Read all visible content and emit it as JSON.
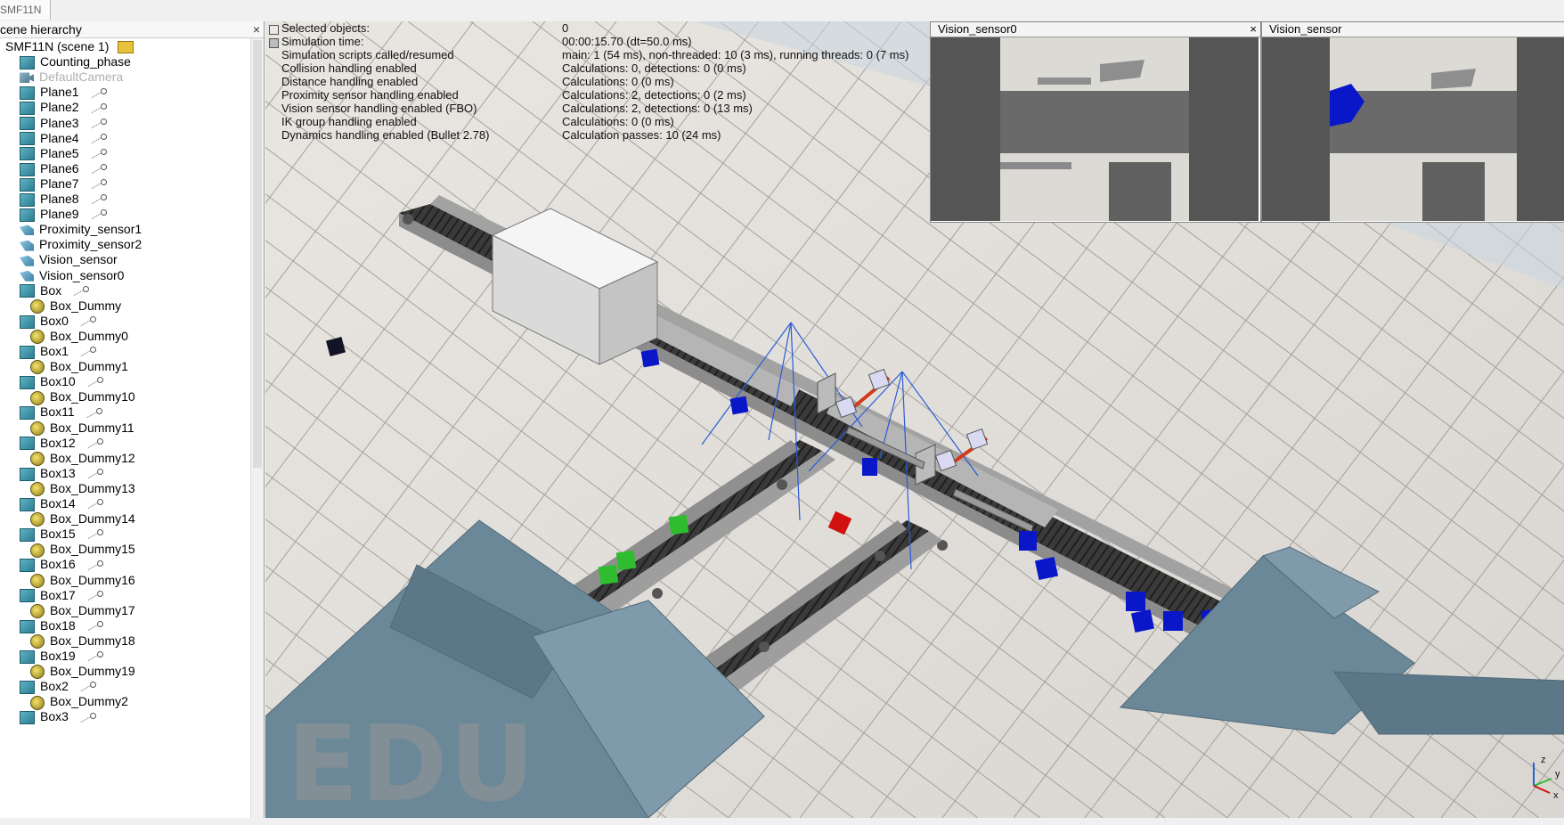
{
  "window": {
    "tab_title": "SMF11N"
  },
  "hierarchy": {
    "title": "cene hierarchy",
    "close": "×",
    "items": [
      {
        "label": "SMF11N (scene 1)",
        "icon": "scene-icon",
        "indent": 0
      },
      {
        "label": "Counting_phase",
        "icon": "box-icon",
        "indent": 1
      },
      {
        "label": "DefaultCamera",
        "icon": "camera-icon",
        "indent": 1,
        "disabled": true
      },
      {
        "label": "Plane1",
        "icon": "box-icon",
        "indent": 1,
        "link": true
      },
      {
        "label": "Plane2",
        "icon": "box-icon",
        "indent": 1,
        "link": true
      },
      {
        "label": "Plane3",
        "icon": "box-icon",
        "indent": 1,
        "link": true
      },
      {
        "label": "Plane4",
        "icon": "box-icon",
        "indent": 1,
        "link": true
      },
      {
        "label": "Plane5",
        "icon": "box-icon",
        "indent": 1,
        "link": true
      },
      {
        "label": "Plane6",
        "icon": "box-icon",
        "indent": 1,
        "link": true
      },
      {
        "label": "Plane7",
        "icon": "box-icon",
        "indent": 1,
        "link": true
      },
      {
        "label": "Plane8",
        "icon": "box-icon",
        "indent": 1,
        "link": true
      },
      {
        "label": "Plane9",
        "icon": "box-icon",
        "indent": 1,
        "link": true
      },
      {
        "label": "Proximity_sensor1",
        "icon": "proximity-sensor-icon",
        "indent": 1
      },
      {
        "label": "Proximity_sensor2",
        "icon": "proximity-sensor-icon",
        "indent": 1
      },
      {
        "label": "Vision_sensor",
        "icon": "vision-sensor-icon",
        "indent": 1
      },
      {
        "label": "Vision_sensor0",
        "icon": "vision-sensor-icon",
        "indent": 1
      },
      {
        "label": "Box",
        "icon": "box-icon",
        "indent": 1,
        "link": true
      },
      {
        "label": "Box_Dummy",
        "icon": "dummy-icon",
        "indent": 2
      },
      {
        "label": "Box0",
        "icon": "box-icon",
        "indent": 1,
        "link": true
      },
      {
        "label": "Box_Dummy0",
        "icon": "dummy-icon",
        "indent": 2
      },
      {
        "label": "Box1",
        "icon": "box-icon",
        "indent": 1,
        "link": true
      },
      {
        "label": "Box_Dummy1",
        "icon": "dummy-icon",
        "indent": 2
      },
      {
        "label": "Box10",
        "icon": "box-icon",
        "indent": 1,
        "link": true
      },
      {
        "label": "Box_Dummy10",
        "icon": "dummy-icon",
        "indent": 2
      },
      {
        "label": "Box11",
        "icon": "box-icon",
        "indent": 1,
        "link": true
      },
      {
        "label": "Box_Dummy11",
        "icon": "dummy-icon",
        "indent": 2
      },
      {
        "label": "Box12",
        "icon": "box-icon",
        "indent": 1,
        "link": true
      },
      {
        "label": "Box_Dummy12",
        "icon": "dummy-icon",
        "indent": 2
      },
      {
        "label": "Box13",
        "icon": "box-icon",
        "indent": 1,
        "link": true
      },
      {
        "label": "Box_Dummy13",
        "icon": "dummy-icon",
        "indent": 2
      },
      {
        "label": "Box14",
        "icon": "box-icon",
        "indent": 1,
        "link": true
      },
      {
        "label": "Box_Dummy14",
        "icon": "dummy-icon",
        "indent": 2
      },
      {
        "label": "Box15",
        "icon": "box-icon",
        "indent": 1,
        "link": true
      },
      {
        "label": "Box_Dummy15",
        "icon": "dummy-icon",
        "indent": 2
      },
      {
        "label": "Box16",
        "icon": "box-icon",
        "indent": 1,
        "link": true
      },
      {
        "label": "Box_Dummy16",
        "icon": "dummy-icon",
        "indent": 2
      },
      {
        "label": "Box17",
        "icon": "box-icon",
        "indent": 1,
        "link": true
      },
      {
        "label": "Box_Dummy17",
        "icon": "dummy-icon",
        "indent": 2
      },
      {
        "label": "Box18",
        "icon": "box-icon",
        "indent": 1,
        "link": true
      },
      {
        "label": "Box_Dummy18",
        "icon": "dummy-icon",
        "indent": 2
      },
      {
        "label": "Box19",
        "icon": "box-icon",
        "indent": 1,
        "link": true
      },
      {
        "label": "Box_Dummy19",
        "icon": "dummy-icon",
        "indent": 2
      },
      {
        "label": "Box2",
        "icon": "box-icon",
        "indent": 1,
        "link": true
      },
      {
        "label": "Box_Dummy2",
        "icon": "dummy-icon",
        "indent": 2
      },
      {
        "label": "Box3",
        "icon": "box-icon",
        "indent": 1,
        "link": true
      }
    ]
  },
  "stats": [
    {
      "label": "Selected objects:",
      "value": "0"
    },
    {
      "label": "Simulation time:",
      "value": "00:00:15.70 (dt=50.0 ms)"
    },
    {
      "label": "Simulation scripts called/resumed",
      "value": "main: 1 (54 ms), non-threaded: 10 (3 ms), running threads: 0 (7 ms)"
    },
    {
      "label": "Collision handling enabled",
      "value": "Calculations: 0, detections: 0 (0 ms)"
    },
    {
      "label": "Distance handling enabled",
      "value": "Calculations: 0 (0 ms)"
    },
    {
      "label": "Proximity sensor handling enabled",
      "value": "Calculations: 2, detections: 0 (2 ms)"
    },
    {
      "label": "Vision sensor handling enabled (FBO)",
      "value": "Calculations: 2, detections: 0 (13 ms)"
    },
    {
      "label": "IK group handling enabled",
      "value": "Calculations: 0 (0 ms)"
    },
    {
      "label": "Dynamics handling enabled (Bullet 2.78)",
      "value": "Calculation passes: 10 (24 ms)"
    }
  ],
  "vision_views": [
    {
      "title": "Vision_sensor0",
      "close": "×"
    },
    {
      "title": "Vision_sensor"
    }
  ],
  "watermark": "EDU",
  "axes": {
    "x": "x",
    "y": "y",
    "z": "z"
  },
  "colors": {
    "floor_light": "#e6e3de",
    "floor_dark": "#b7b3ad",
    "conveyor_belt": "#3a3a3a",
    "conveyor_frame": "#9a9a9a",
    "ramp": "#6b8898",
    "cube_blue": "#0a17c9",
    "cube_green": "#2fbd2f",
    "cube_red": "#d11010",
    "sensor_line": "#2a5bd8"
  }
}
